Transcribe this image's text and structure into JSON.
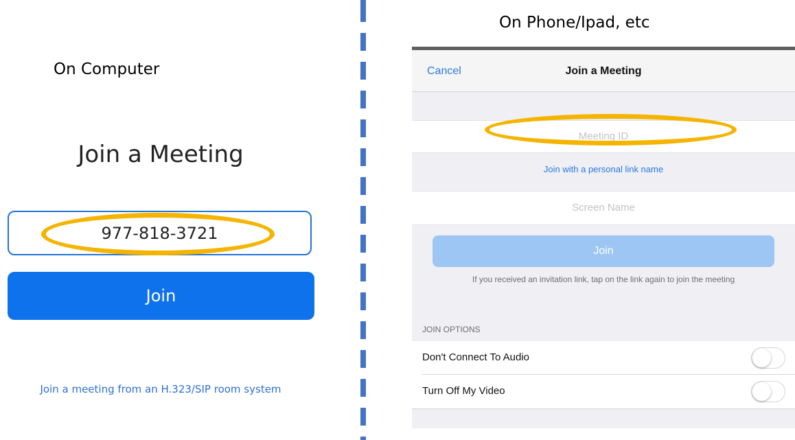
{
  "left_panel": {
    "caption": "On Computer",
    "title": "Join a Meeting",
    "meeting_id_value": "977-818-3721",
    "join_label": "Join",
    "sip_link": "Join a meeting from an H.323/SIP room system"
  },
  "right_panel": {
    "caption": "On Phone/Ipad, etc",
    "nav": {
      "cancel_label": "Cancel",
      "title": "Join a Meeting"
    },
    "meeting_id_placeholder": "Meeting ID",
    "personal_link": "Join with a personal link name",
    "screen_name_placeholder": "Screen Name",
    "join_label": "Join",
    "hint": "If you received an invitation link, tap on the link again to join the meeting",
    "options_header": "JOIN OPTIONS",
    "options": [
      {
        "label": "Don't Connect To Audio",
        "enabled": false
      },
      {
        "label": "Turn Off My Video",
        "enabled": false
      }
    ]
  },
  "colors": {
    "highlight": "#f4b400",
    "divider": "#4472c4",
    "desktop_join": "#0e72ed",
    "phone_join": "#9dc6f4",
    "link": "#2a7ae2"
  }
}
